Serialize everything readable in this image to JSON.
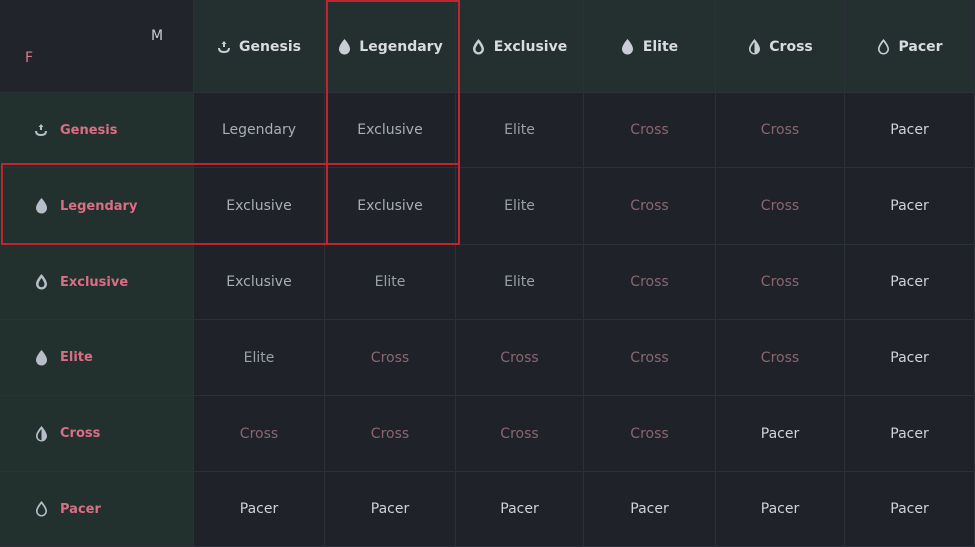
{
  "corner": {
    "top_right": "M",
    "bottom_left": "F"
  },
  "columns": [
    {
      "label": "Genesis",
      "icon": "genesis-icon"
    },
    {
      "label": "Legendary",
      "icon": "drop-legendary-icon"
    },
    {
      "label": "Exclusive",
      "icon": "drop-exclusive-icon"
    },
    {
      "label": "Elite",
      "icon": "drop-elite-icon"
    },
    {
      "label": "Cross",
      "icon": "drop-cross-icon"
    },
    {
      "label": "Pacer",
      "icon": "drop-pacer-icon"
    }
  ],
  "rows": [
    {
      "label": "Genesis",
      "icon": "genesis-icon",
      "cells": [
        "Legendary",
        "Exclusive",
        "Elite",
        "Cross",
        "Cross",
        "Pacer"
      ]
    },
    {
      "label": "Legendary",
      "icon": "drop-legendary-icon",
      "cells": [
        "Exclusive",
        "Exclusive",
        "Elite",
        "Cross",
        "Cross",
        "Pacer"
      ]
    },
    {
      "label": "Exclusive",
      "icon": "drop-exclusive-icon",
      "cells": [
        "Exclusive",
        "Elite",
        "Elite",
        "Cross",
        "Cross",
        "Pacer"
      ]
    },
    {
      "label": "Elite",
      "icon": "drop-elite-icon",
      "cells": [
        "Elite",
        "Cross",
        "Cross",
        "Cross",
        "Cross",
        "Pacer"
      ]
    },
    {
      "label": "Cross",
      "icon": "drop-cross-icon",
      "cells": [
        "Cross",
        "Cross",
        "Cross",
        "Cross",
        "Pacer",
        "Pacer"
      ]
    },
    {
      "label": "Pacer",
      "icon": "drop-pacer-icon",
      "cells": [
        "Pacer",
        "Pacer",
        "Pacer",
        "Pacer",
        "Pacer",
        "Pacer"
      ]
    }
  ],
  "colors": {
    "highlight": "#c0242f",
    "row_label": "#d86f86",
    "header_bg": "#24302f",
    "body_bg": "#1f2229"
  }
}
